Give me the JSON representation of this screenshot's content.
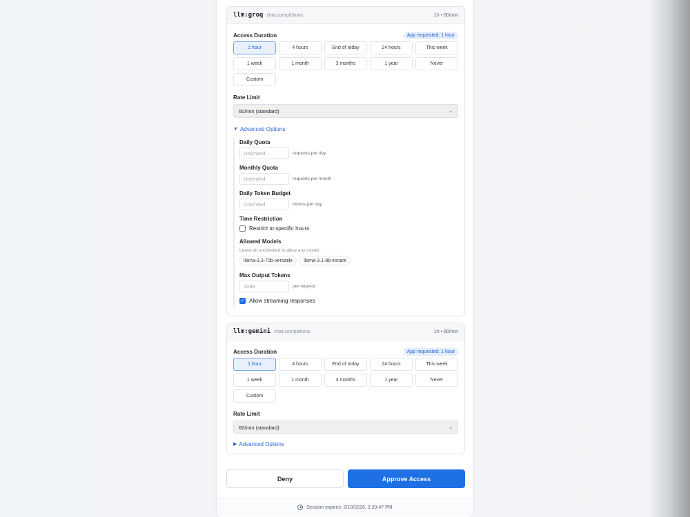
{
  "duration_options": [
    "1 hour",
    "4 hours",
    "End of today",
    "24 hours",
    "This week",
    "1 week",
    "1 month",
    "3 months",
    "1 year",
    "Never",
    "Custom"
  ],
  "groq": {
    "name": "llm:groq",
    "operation": "chat.completions",
    "rate_summary": "1h • 60/min",
    "access_duration_label": "Access Duration",
    "requested_badge": "App requested: 1 hour",
    "selected_duration": "1 hour",
    "rate_limit_label": "Rate Limit",
    "rate_limit_value": "60/min (standard)",
    "advanced_toggle": "Advanced Options",
    "advanced": {
      "daily_quota_label": "Daily Quota",
      "daily_quota_placeholder": "Unlimited",
      "daily_quota_suffix": "requests per day",
      "monthly_quota_label": "Monthly Quota",
      "monthly_quota_placeholder": "Unlimited",
      "monthly_quota_suffix": "requests per month",
      "token_budget_label": "Daily Token Budget",
      "token_budget_placeholder": "Unlimited",
      "token_budget_suffix": "tokens per day",
      "time_restriction_label": "Time Restriction",
      "time_restriction_checkbox": "Restrict to specific hours",
      "allowed_models_label": "Allowed Models",
      "allowed_models_hint": "Leave all unchecked to allow any model",
      "models": [
        "llama-3.3-70b-versatile",
        "llama-3.1-8b-instant"
      ],
      "max_output_label": "Max Output Tokens",
      "max_output_placeholder": "4096",
      "max_output_suffix": "per request",
      "streaming_checkbox": "Allow streaming responses"
    }
  },
  "gemini": {
    "name": "llm:gemini",
    "operation": "chat.completions",
    "rate_summary": "1h • 60/min",
    "access_duration_label": "Access Duration",
    "requested_badge": "App requested: 1 hour",
    "selected_duration": "1 hour",
    "rate_limit_label": "Rate Limit",
    "rate_limit_value": "60/min (standard)",
    "advanced_toggle": "Advanced Options"
  },
  "actions": {
    "deny": "Deny",
    "approve": "Approve Access"
  },
  "footer": {
    "session_expires": "Session expires: 2/10/2026, 2:39:47 PM"
  },
  "colors": {
    "accent": "#1f6fe5",
    "badge_bg": "#e3edfc",
    "link": "#2a67d8"
  }
}
